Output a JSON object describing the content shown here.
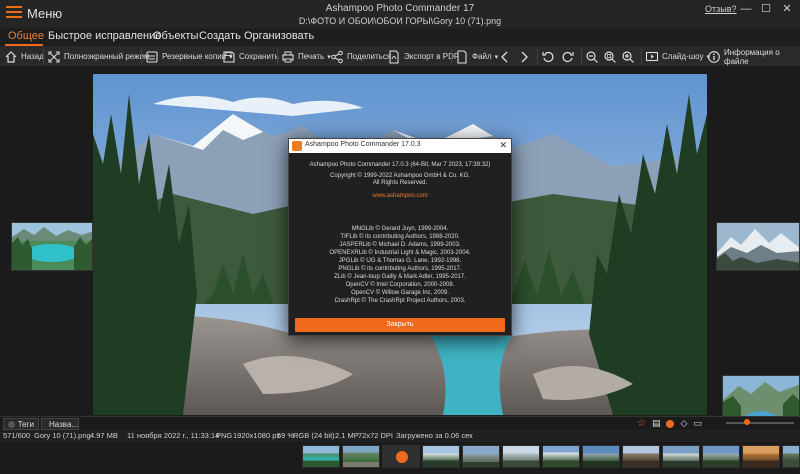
{
  "titlebar": {
    "menu_label": "Меню",
    "app_title": "Ashampoo Photo Commander 17",
    "path": "D:\\ФОТО И ОБОИ\\ОБОИ ГОРЫ\\Gory 10 (71).png",
    "feedback": "Отзыв?",
    "minimize": "—",
    "maximize": "☐",
    "close": "✕"
  },
  "menu": {
    "items": [
      "Общее",
      "Быстрое исправление",
      "Объекты",
      "Создать",
      "Организовать"
    ],
    "active_color": "#f06a1d"
  },
  "toolbar": {
    "back": "Назад",
    "fullscreen": "Полноэкранный режим",
    "backups": "Резервные копии",
    "save": "Сохранить",
    "print": "Печать",
    "share": "Поделиться",
    "export_pdf": "Экспорт в PDF",
    "file": "Файл",
    "slideshow": "Слайд-шоу",
    "file_info": "Информация о файле"
  },
  "dialog": {
    "title": "Ashampoo Photo Commander 17.0.3",
    "version": "Ashampoo Photo Commander 17.0.3 (64-Bit, Mar  7 2023, 17:39:32)",
    "copyright": "Copyright © 1999-2022 Ashampoo GmbH & Co. KG.",
    "rights": "All Rights Reserved.",
    "website": "www.ashampoo.com",
    "credits": [
      "MNGLib © Gerard Juyn, 1999-2004.",
      "TIFLib © its contributing Authors, 1988-2020.",
      "JASPERLib © Michael D. Adams, 1999-2003.",
      "OPENEXRLib © Industrial Light & Magic, 2003-2004.",
      "JPGLib © IJG & Thomas G. Lane, 1992-1998.",
      "PNGLib © its contributing Authors, 1995-2017.",
      "ZLib © Jean-loup Gailly & Mark Adler, 1995-2017.",
      "OpenCV © Intel Corporation, 2000-2008.",
      "OpenCV © Willow Garage Inc, 2009.",
      "CrashRpt © The CrashRpt Project Authors, 2003."
    ],
    "close_button": "Закрыть"
  },
  "tagbar": {
    "tags": "Теги",
    "name": "Назва..."
  },
  "status": {
    "index": "571/600",
    "filename": "Gory 10 (71).png",
    "filesize": "4.97 MB",
    "datetime": "11 ноября 2022 г., 11:33:14",
    "format": "PNG",
    "dimensions": "1920x1080 px",
    "zoom": "59 %",
    "color": "RGB (24 bit)",
    "megapixels": "2.1 MP",
    "dpi": "72x72 DPI",
    "load_time": "Загружено за 0.06 сек"
  },
  "colors": {
    "accent": "#f06a1d",
    "background": "#1e1e1e",
    "toolbar": "#2a2a2a"
  }
}
